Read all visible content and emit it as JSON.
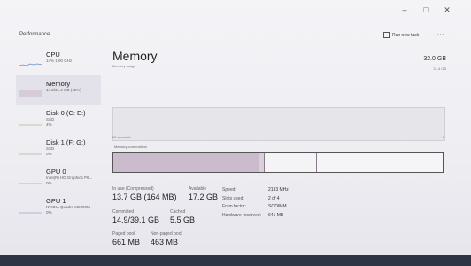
{
  "window": {
    "header": "Performance",
    "run_task": "Run new task",
    "more": "...",
    "controls": [
      "–",
      "□",
      "✕"
    ]
  },
  "sidebar": {
    "items": [
      {
        "title": "CPU",
        "sub": "14%  1.90 GHz",
        "sub2": ""
      },
      {
        "title": "Memory",
        "sub": "14.2/31.4 GB (45%)",
        "sub2": ""
      },
      {
        "title": "Disk 0 (C: E:)",
        "sub": "SSD",
        "sub2": "4%"
      },
      {
        "title": "Disk 1 (F: G:)",
        "sub": "SSD",
        "sub2": "0%"
      },
      {
        "title": "GPU 0",
        "sub": "Intel(R) HD Graphics P6...",
        "sub2": "0%"
      },
      {
        "title": "GPU 1",
        "sub": "NVIDIA Quadro M2000M",
        "sub2": "0%"
      }
    ]
  },
  "main": {
    "title": "Memory",
    "capacity": "32.0 GB",
    "usage_label": "Memory usage",
    "usage_max": "31.4 GB",
    "graph_left": "60 seconds",
    "graph_right": "0",
    "composition_label": "Memory composition",
    "composition": {
      "in_use_frac": 0.44,
      "modified_frac": 0.013,
      "standby_frac": 0.155
    }
  },
  "stats": {
    "in_use_label": "In use (Compressed)",
    "in_use_value": "13.7 GB (164 MB)",
    "available_label": "Available",
    "available_value": "17.2 GB",
    "committed_label": "Committed",
    "committed_value": "14.9/39.1 GB",
    "cached_label": "Cached",
    "cached_value": "5.5 GB",
    "paged_label": "Paged pool",
    "paged_value": "661 MB",
    "nonpaged_label": "Non-paged pool",
    "nonpaged_value": "463 MB"
  },
  "hardware": {
    "speed_label": "Speed:",
    "speed_value": "2133 MHz",
    "slots_label": "Slots used:",
    "slots_value": "2 of 4",
    "form_label": "Form factor:",
    "form_value": "SODIMM",
    "reserved_label": "Hardware reserved:",
    "reserved_value": "641 MB"
  }
}
